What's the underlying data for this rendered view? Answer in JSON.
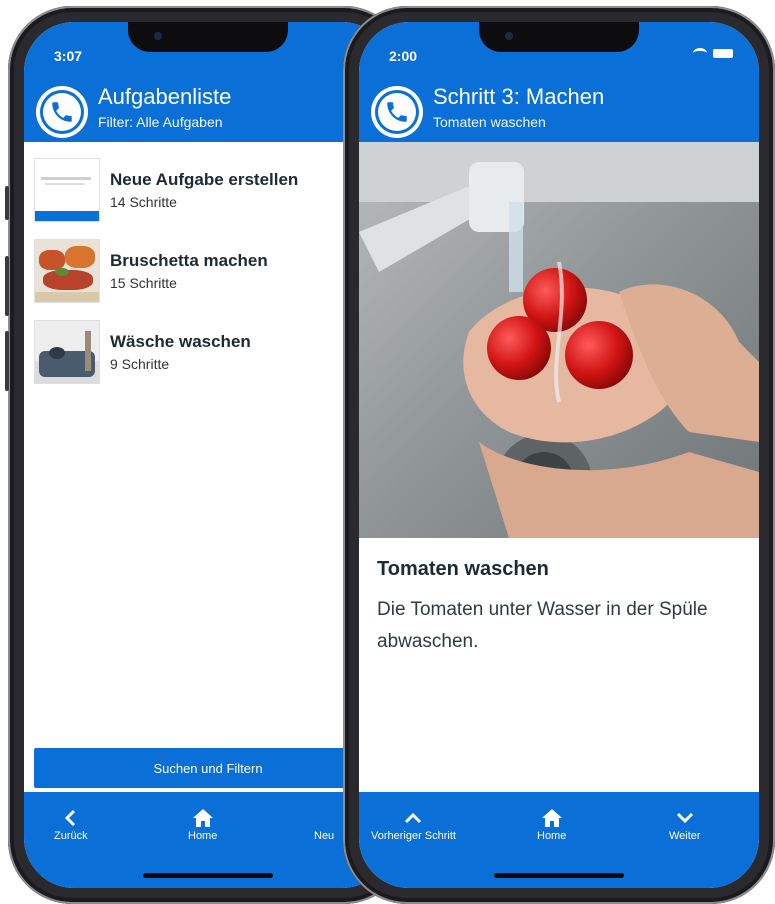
{
  "left_phone": {
    "status": {
      "time": "3:07"
    },
    "header": {
      "title": "Aufgabenliste",
      "subtitle": "Filter: Alle Aufgaben"
    },
    "tasks": [
      {
        "name": "Neue Aufgabe erstellen",
        "steps": "14 Schritte"
      },
      {
        "name": "Bruschetta machen",
        "steps": "15 Schritte"
      },
      {
        "name": "Wäsche waschen",
        "steps": "9 Schritte"
      }
    ],
    "search_button": "Suchen und Filtern",
    "nav": {
      "back": "Zurück",
      "home": "Home",
      "new": "Neu"
    }
  },
  "right_phone": {
    "status": {
      "time": "2:00"
    },
    "header": {
      "title": "Schritt 3: Machen",
      "subtitle": "Tomaten waschen"
    },
    "step": {
      "title": "Tomaten waschen",
      "description": "Die Tomaten unter Wasser in der Spüle abwaschen."
    },
    "nav": {
      "prev": "Vorheriger Schritt",
      "home": "Home",
      "next": "Weiter"
    }
  },
  "colors": {
    "accent": "#0a6fd6",
    "text": "#1d2a35"
  }
}
